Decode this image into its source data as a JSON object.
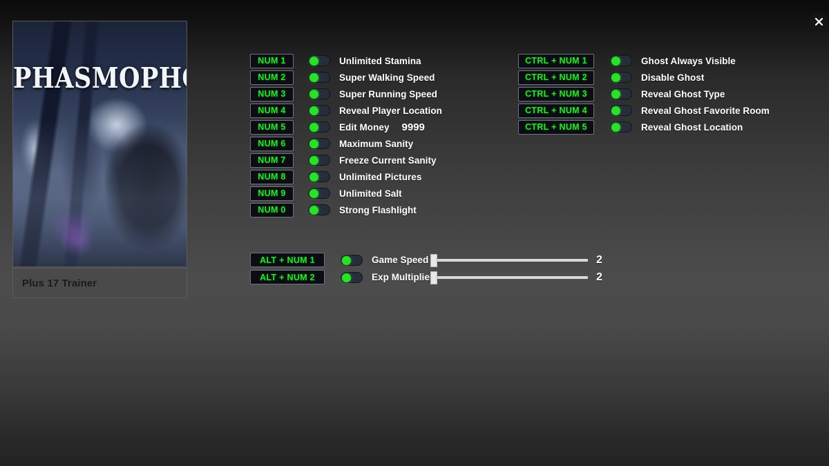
{
  "window": {
    "close_icon": "close-icon"
  },
  "game": {
    "cover_title": "PHASMOPHOBIA",
    "trainer_name": "Plus 17 Trainer"
  },
  "cheats": {
    "left_column": [
      {
        "hotkey": "NUM 1",
        "label": "Unlimited Stamina",
        "toggle": "on",
        "value": ""
      },
      {
        "hotkey": "NUM 2",
        "label": "Super Walking Speed",
        "toggle": "on",
        "value": ""
      },
      {
        "hotkey": "NUM 3",
        "label": "Super Running Speed",
        "toggle": "on",
        "value": ""
      },
      {
        "hotkey": "NUM 4",
        "label": "Reveal Player Location",
        "toggle": "on",
        "value": ""
      },
      {
        "hotkey": "NUM 5",
        "label": "Edit Money",
        "toggle": "on",
        "value": "9999"
      },
      {
        "hotkey": "NUM 6",
        "label": "Maximum Sanity",
        "toggle": "on",
        "value": ""
      },
      {
        "hotkey": "NUM 7",
        "label": "Freeze Current Sanity",
        "toggle": "on",
        "value": ""
      },
      {
        "hotkey": "NUM 8",
        "label": "Unlimited Pictures",
        "toggle": "on",
        "value": ""
      },
      {
        "hotkey": "NUM 9",
        "label": "Unlimited Salt",
        "toggle": "on",
        "value": ""
      },
      {
        "hotkey": "NUM 0",
        "label": "Strong Flashlight",
        "toggle": "on",
        "value": ""
      }
    ],
    "right_column": [
      {
        "hotkey": "CTRL + NUM 1",
        "label": "Ghost Always Visible",
        "toggle": "on"
      },
      {
        "hotkey": "CTRL + NUM 2",
        "label": "Disable Ghost",
        "toggle": "on"
      },
      {
        "hotkey": "CTRL + NUM 3",
        "label": "Reveal Ghost Type",
        "toggle": "on"
      },
      {
        "hotkey": "CTRL + NUM 4",
        "label": "Reveal Ghost Favorite Room",
        "toggle": "on"
      },
      {
        "hotkey": "CTRL + NUM 5",
        "label": "Reveal Ghost Location",
        "toggle": "on"
      }
    ],
    "slider_rows": [
      {
        "hotkey": "ALT + NUM 1",
        "label": "Game Speed",
        "toggle": "on",
        "value": "2",
        "handle_pct": 0
      },
      {
        "hotkey": "ALT + NUM 2",
        "label": "Exp Multiplier",
        "toggle": "on",
        "value": "2",
        "handle_pct": 0
      }
    ]
  },
  "colors": {
    "hotkey_green": "#2de02d",
    "toggle_knob_green": "#2ae02a",
    "toggle_track": "#272d3b",
    "label_white": "#ffffff",
    "trainer_bar": "#4a4a4a"
  }
}
